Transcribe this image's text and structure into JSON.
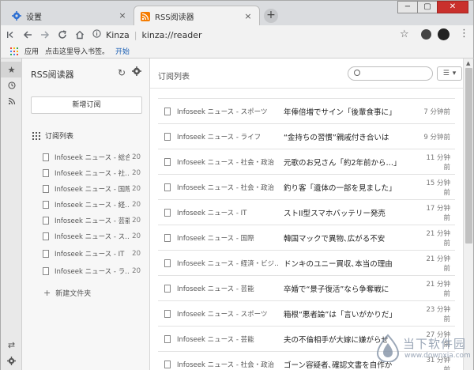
{
  "tabs": [
    {
      "label": "设置",
      "close": "×"
    },
    {
      "label": "RSS阅读器",
      "close": "×"
    }
  ],
  "newtab": "+",
  "window": {
    "minimize": "−",
    "maximize": "▢",
    "close": "✕"
  },
  "address": {
    "site": "Kinza",
    "url": "kinza://reader"
  },
  "bookmarks": {
    "apps": "应用",
    "import_hint": "点击这里导入书签。",
    "start": "开始"
  },
  "sidebar": {
    "title": "RSS阅读器",
    "new_subscription": "新增订阅",
    "list_header": "订阅列表",
    "feeds": [
      {
        "label": "Infoseek ニュース - 総合",
        "count": "20"
      },
      {
        "label": "Infoseek ニュース - 社…",
        "count": "20"
      },
      {
        "label": "Infoseek ニュース - 国際",
        "count": "20"
      },
      {
        "label": "Infoseek ニュース - 経…",
        "count": "20"
      },
      {
        "label": "Infoseek ニュース - 芸能",
        "count": "20"
      },
      {
        "label": "Infoseek ニュース - ス…",
        "count": "20"
      },
      {
        "label": "Infoseek ニュース - IT",
        "count": "20"
      },
      {
        "label": "Infoseek ニュース - ラ…",
        "count": "20"
      }
    ],
    "new_folder": "新建文件夹"
  },
  "main": {
    "title": "订阅列表",
    "search_placeholder": "",
    "articles": [
      {
        "feed": "Infoseek ニュース - スポーツ",
        "title": "年俸倍増でサイン「後輩食事に」",
        "time": "7 分钟前"
      },
      {
        "feed": "Infoseek ニュース - ライフ",
        "title": "“金持ちの習慣”親戚付き合いは",
        "time": "9 分钟前"
      },
      {
        "feed": "Infoseek ニュース - 社会・政治",
        "title": "元歌のお兄さん「約2年前から…」",
        "time": "11 分钟前"
      },
      {
        "feed": "Infoseek ニュース - 社会・政治",
        "title": "釣り客「遺体の一部を見ました」",
        "time": "15 分钟前"
      },
      {
        "feed": "Infoseek ニュース - IT",
        "title": "ストII型スマホバッテリー発売",
        "time": "17 分钟前"
      },
      {
        "feed": "Infoseek ニュース - 国際",
        "title": "韓国マックで異物､広がる不安",
        "time": "21 分钟前"
      },
      {
        "feed": "Infoseek ニュース - 経済・ビジ…",
        "title": "ドンキのユニー買収､本当の理由",
        "time": "21 分钟前"
      },
      {
        "feed": "Infoseek ニュース - 芸能",
        "title": "卒婚で“景子復活”なら争奪戦に",
        "time": "21 分钟前"
      },
      {
        "feed": "Infoseek ニュース - スポーツ",
        "title": "箱根“悪者論”は「言いがかりだ」",
        "time": "23 分钟前"
      },
      {
        "feed": "Infoseek ニュース - 芸能",
        "title": "夫の不倫相手が大嫁に嫌がらせ",
        "time": "27 分钟前"
      },
      {
        "feed": "Infoseek ニュース - 社会・政治",
        "title": "ゴーン容疑者､確認文書を自作か",
        "time": "31 分钟前"
      }
    ]
  },
  "watermark": {
    "text": "当下软件园",
    "url": "www.downxia.com"
  },
  "colors": {
    "rss": "#f57c00",
    "settings_gear": "#2d6fd2",
    "apps": [
      "#ea4335",
      "#fbbc05",
      "#34a853",
      "#4285f4"
    ]
  }
}
